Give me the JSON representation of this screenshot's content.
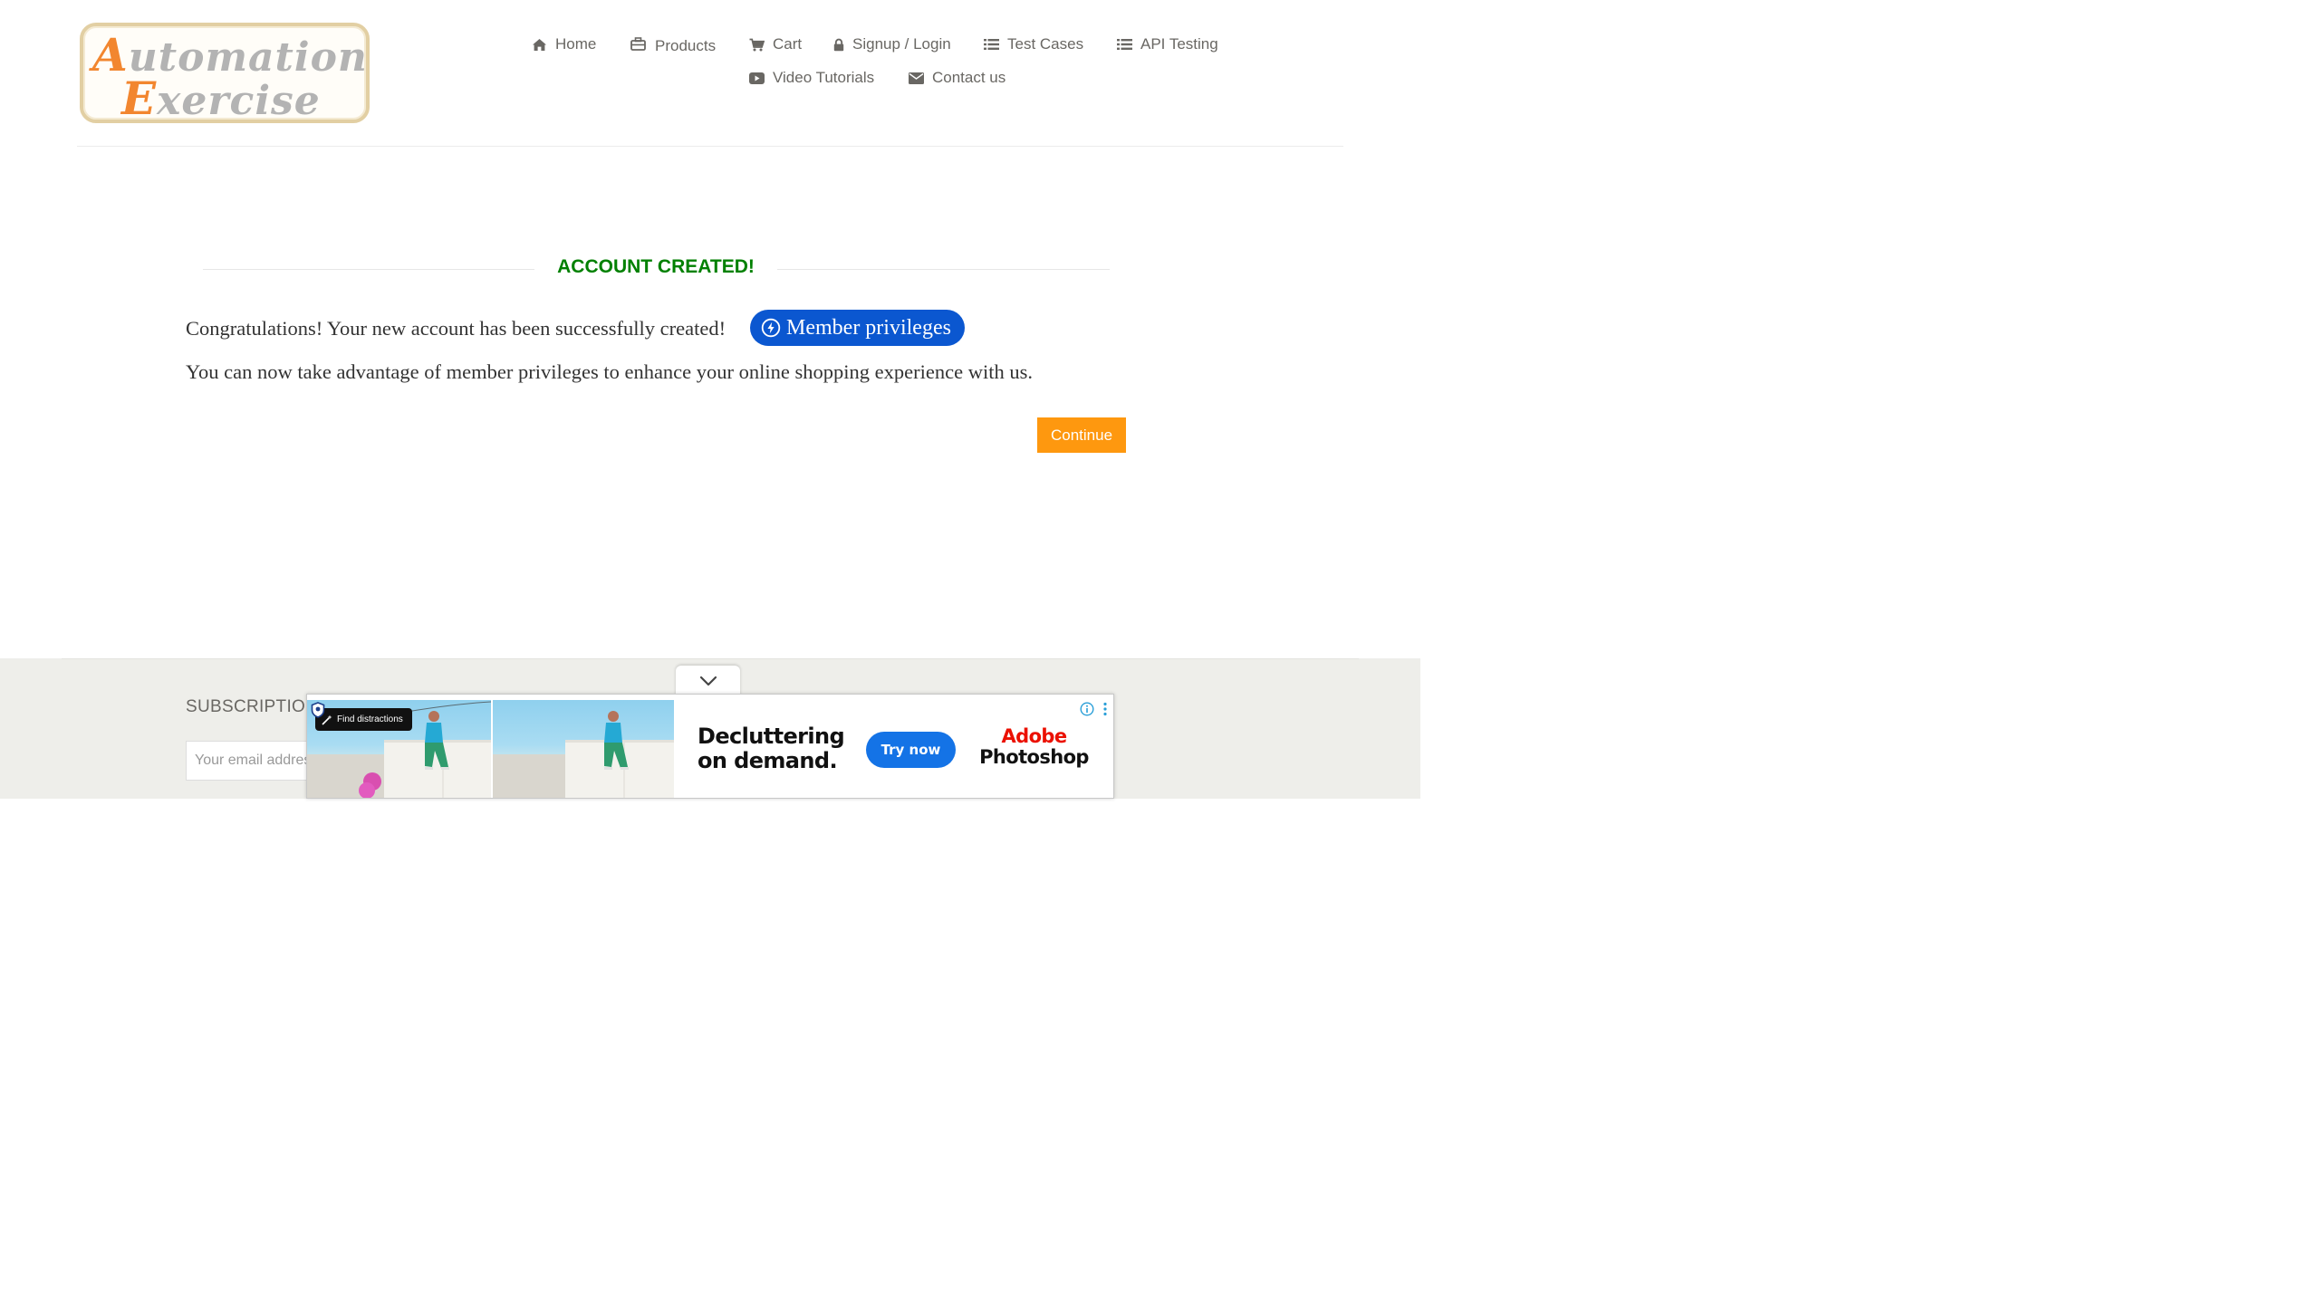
{
  "header": {
    "logo": {
      "line1_cap": "A",
      "line1_rest": "utomation",
      "line2_cap": "E",
      "line2_rest": "xercise"
    },
    "nav": [
      {
        "label": "Home",
        "icon": "home-icon"
      },
      {
        "label": "Products",
        "icon": "briefcase-icon"
      },
      {
        "label": "Cart",
        "icon": "cart-icon"
      },
      {
        "label": "Signup / Login",
        "icon": "lock-icon"
      },
      {
        "label": "Test Cases",
        "icon": "list-icon"
      },
      {
        "label": "API Testing",
        "icon": "list-icon"
      },
      {
        "label": "Video Tutorials",
        "icon": "youtube-play-icon"
      },
      {
        "label": "Contact us",
        "icon": "envelope-icon"
      }
    ]
  },
  "main": {
    "title": "ACCOUNT CREATED!",
    "message1": "Congratulations! Your new account has been successfully created!",
    "member_button": "Member privileges",
    "message2": "You can now take advantage of member privileges to enhance your online shopping experience with us.",
    "continue": "Continue"
  },
  "footer": {
    "subscription_title": "SUBSCRIPTION",
    "email_placeholder": "Your email address"
  },
  "ad": {
    "find_distractions": "Find distractions",
    "headline_line1": "Decluttering",
    "headline_line2": "on demand.",
    "cta": "Try now",
    "brand_line1": "Adobe",
    "brand_line2": "Photoshop"
  },
  "colors": {
    "accent_orange": "#fe980f",
    "title_green": "#008000",
    "member_blue": "#0b57d0",
    "ad_blue": "#1473e6",
    "adobe_red": "#eb1000"
  }
}
